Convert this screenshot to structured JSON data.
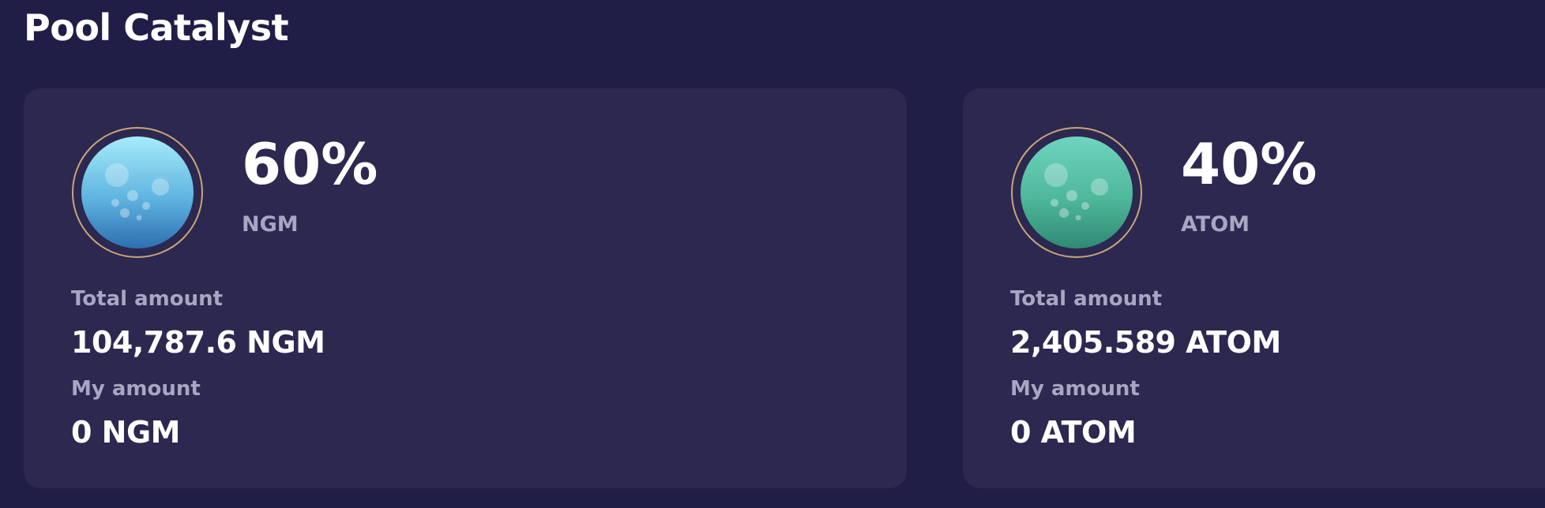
{
  "page": {
    "title": "Pool Catalyst"
  },
  "assets": [
    {
      "percent": "60%",
      "symbol": "NGM",
      "total_label": "Total amount",
      "total_value": "104,787.6 NGM",
      "my_label": "My amount",
      "my_value": "0 NGM",
      "icon": "ngm-token-icon",
      "color": "#5fb4e0"
    },
    {
      "percent": "40%",
      "symbol": "ATOM",
      "total_label": "Total amount",
      "total_value": "2,405.589 ATOM",
      "my_label": "My amount",
      "my_value": "0 ATOM",
      "icon": "atom-token-icon",
      "color": "#4fb89a"
    }
  ],
  "colors": {
    "background": "#201e46",
    "card": "#2c2850",
    "muted_text": "#a9a6c4",
    "ring": "#c9a77a"
  }
}
